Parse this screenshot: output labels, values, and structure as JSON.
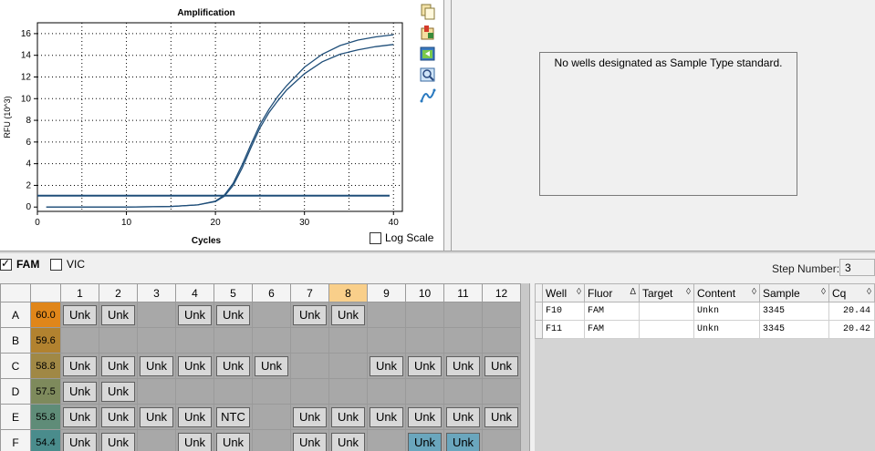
{
  "chart": {
    "toolbar_icons": [
      "copy-icon",
      "export-icon",
      "refresh-icon",
      "zoom-icon",
      "curve-settings-icon"
    ],
    "log_scale_label": "Log Scale",
    "log_scale_checked": false
  },
  "chart_data": {
    "type": "line",
    "title": "Amplification",
    "xlabel": "Cycles",
    "ylabel": "RFU (10^3)",
    "xlim": [
      0,
      41
    ],
    "ylim": [
      -0.4,
      17
    ],
    "xticks": [
      0,
      10,
      20,
      30,
      40
    ],
    "yticks": [
      0,
      2,
      4,
      6,
      8,
      10,
      12,
      14,
      16
    ],
    "grid": true,
    "threshold": 1.05,
    "series": [
      {
        "x": [
          1,
          5,
          10,
          15,
          18,
          20,
          21,
          22,
          23,
          24,
          25,
          26,
          27,
          28,
          30,
          32,
          34,
          36,
          38,
          40
        ],
        "y": [
          0,
          0,
          0,
          0.05,
          0.2,
          0.55,
          1.1,
          2.2,
          3.9,
          5.8,
          7.6,
          9.0,
          10.2,
          11.2,
          12.9,
          14.1,
          14.9,
          15.4,
          15.7,
          15.9
        ]
      },
      {
        "x": [
          1,
          5,
          10,
          15,
          18,
          20,
          21,
          22,
          23,
          24,
          25,
          26,
          27,
          28,
          30,
          32,
          34,
          36,
          38,
          40
        ],
        "y": [
          0,
          0,
          0,
          0.05,
          0.2,
          0.5,
          1.0,
          2.0,
          3.6,
          5.5,
          7.3,
          8.7,
          9.8,
          10.8,
          12.3,
          13.4,
          14.1,
          14.5,
          14.8,
          15.0
        ]
      }
    ],
    "line_color": "#1f4e79",
    "threshold_color": "#1f4e79"
  },
  "standard_curve": {
    "message": "No wells designated as Sample Type standard."
  },
  "fluors": [
    {
      "label": "FAM",
      "checked": true,
      "bold": true
    },
    {
      "label": "VIC",
      "checked": false,
      "bold": false
    }
  ],
  "step": {
    "label": "Step Number:",
    "value": "3"
  },
  "plate": {
    "columns": [
      "1",
      "2",
      "3",
      "4",
      "5",
      "6",
      "7",
      "8",
      "9",
      "10",
      "11",
      "12"
    ],
    "highlight_column": "8",
    "rows": [
      {
        "label": "A",
        "temp": "60.0",
        "temp_color": "#e0861a",
        "wells": [
          "Unk",
          "Unk",
          "",
          "Unk",
          "Unk",
          "",
          "Unk",
          "Unk",
          "",
          "",
          "",
          ""
        ],
        "selected": []
      },
      {
        "label": "B",
        "temp": "59.6",
        "temp_color": "#b2822f",
        "wells": [
          "",
          "",
          "",
          "",
          "",
          "",
          "",
          "",
          "",
          "",
          "",
          ""
        ],
        "selected": []
      },
      {
        "label": "C",
        "temp": "58.8",
        "temp_color": "#a08845",
        "wells": [
          "Unk",
          "Unk",
          "Unk",
          "Unk",
          "Unk",
          "Unk",
          "",
          "",
          "Unk",
          "Unk",
          "Unk",
          "Unk"
        ],
        "selected": []
      },
      {
        "label": "D",
        "temp": "57.5",
        "temp_color": "#7e8a5c",
        "wells": [
          "Unk",
          "Unk",
          "",
          "",
          "",
          "",
          "",
          "",
          "",
          "",
          "",
          ""
        ],
        "selected": []
      },
      {
        "label": "E",
        "temp": "55.8",
        "temp_color": "#5f8c78",
        "wells": [
          "Unk",
          "Unk",
          "Unk",
          "Unk",
          "NTC",
          "",
          "Unk",
          "Unk",
          "Unk",
          "Unk",
          "Unk",
          "Unk"
        ],
        "selected": []
      },
      {
        "label": "F",
        "temp": "54.4",
        "temp_color": "#4a8c8c",
        "wells": [
          "Unk",
          "Unk",
          "",
          "Unk",
          "Unk",
          "",
          "Unk",
          "Unk",
          "",
          "Unk",
          "Unk",
          ""
        ],
        "selected": [
          9,
          10
        ]
      }
    ]
  },
  "results": {
    "columns": [
      {
        "label": "Well",
        "sort": "◊"
      },
      {
        "label": "Fluor",
        "sort": "Δ"
      },
      {
        "label": "Target",
        "sort": "◊"
      },
      {
        "label": "Content",
        "sort": "◊"
      },
      {
        "label": "Sample",
        "sort": "◊"
      },
      {
        "label": "Cq",
        "sort": "◊"
      }
    ],
    "rows": [
      {
        "well": "F10",
        "fluor": "FAM",
        "target": "",
        "content": "Unkn",
        "sample": "3345",
        "cq": "20.44"
      },
      {
        "well": "F11",
        "fluor": "FAM",
        "target": "",
        "content": "Unkn",
        "sample": "3345",
        "cq": "20.42"
      }
    ]
  }
}
